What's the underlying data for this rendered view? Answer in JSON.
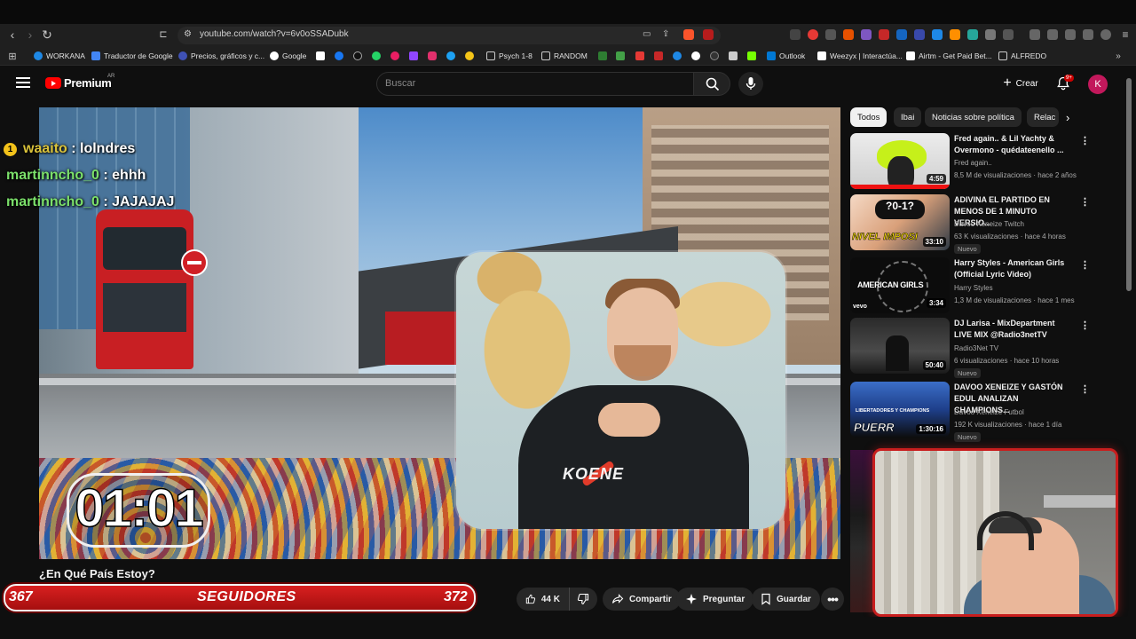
{
  "browser": {
    "url": "youtube.com/watch?v=6v0oSSADubk",
    "bookmarks": [
      {
        "label": "WORKANA",
        "color": "#1e88e5"
      },
      {
        "label": "Traductor de Google",
        "color": "#4285f4"
      },
      {
        "label": "Precios, gráficos y c...",
        "color": "#3f51b5"
      },
      {
        "label": "Google",
        "color": "#ea4335"
      },
      {
        "label": "Psych 1-8",
        "color": "#9e9e9e"
      },
      {
        "label": "RANDOM",
        "color": "#9e9e9e"
      },
      {
        "label": "Outlook",
        "color": "#0078d4"
      },
      {
        "label": "Weezyx | Interactúa...",
        "color": "#ffffff"
      },
      {
        "label": "Airtm - Get Paid Bet...",
        "color": "#ffffff"
      },
      {
        "label": "ALFREDO",
        "color": "#9e9e9e"
      }
    ]
  },
  "header": {
    "logo_label": "Premium",
    "region": "AR",
    "search_placeholder": "Buscar",
    "create_label": "Crear",
    "notifications_badge": "9+",
    "avatar_letter": "K"
  },
  "player": {
    "chat": [
      {
        "user": "waaito",
        "message": "lolndres",
        "badge": "1"
      },
      {
        "user": "martinncho_0",
        "message": "ehhh"
      },
      {
        "user": "martinncho_0",
        "message": "JAJAJAJ"
      }
    ],
    "timer": "01:01",
    "sweater_text": "KOENE"
  },
  "video": {
    "title": "¿En Qué País Estoy?"
  },
  "followers": {
    "current": "367",
    "label": "SEGUIDORES",
    "goal": "372"
  },
  "actions": {
    "likes": "44 K",
    "share": "Compartir",
    "ask": "Preguntar",
    "save": "Guardar"
  },
  "sidebar": {
    "chips": [
      "Todos",
      "Ibai",
      "Noticias sobre política",
      "Relac"
    ],
    "videos": [
      {
        "title": "Fred again.. & Lil Yachty & Overmono - quédateenello ...",
        "channel": "Fred again..",
        "meta": "8,5 M de visualizaciones · hace 2 años",
        "duration": "4:59",
        "new": ""
      },
      {
        "title": "ADIVINA EL PARTIDO EN MENOS DE 1 MINUTO VERSIO...",
        "channel": "Davoo Xeneize Twitch",
        "meta": "63 K visualizaciones · hace 4 horas",
        "duration": "33:10",
        "new": "Nuevo"
      },
      {
        "title": "Harry Styles - American Girls (Official Lyric Video)",
        "channel": "Harry Styles",
        "meta": "1,3 M de visualizaciones · hace 1 mes",
        "duration": "3:34",
        "new": ""
      },
      {
        "title": "DJ Larisa - MixDepartment LIVE MIX @Radio3netTV",
        "channel": "Radio3Net TV",
        "meta": "6 visualizaciones · hace 10 horas",
        "duration": "50:40",
        "new": "Nuevo"
      },
      {
        "title": "DAVOO XENEIZE Y GASTÓN EDUL ANALIZAN CHAMPIONS...",
        "channel": "Davoo Xeneize Futbol",
        "meta": "192 K visualizaciones · hace 1 día",
        "duration": "1:30:16",
        "new": "Nuevo"
      }
    ],
    "thumb_texts": {
      "t2": "NIVEL IMPOSI",
      "t2b": "?0-1?",
      "t3": "AMERICAN GIRLS",
      "t3logo": "vevo",
      "t5": "PUERR",
      "t5b": "LIBERTADORES Y CHAMPIONS"
    }
  },
  "colors": {
    "accent": "#ff0000",
    "follower_bar": "#c81e1e",
    "chat_user": "#7be06a"
  }
}
